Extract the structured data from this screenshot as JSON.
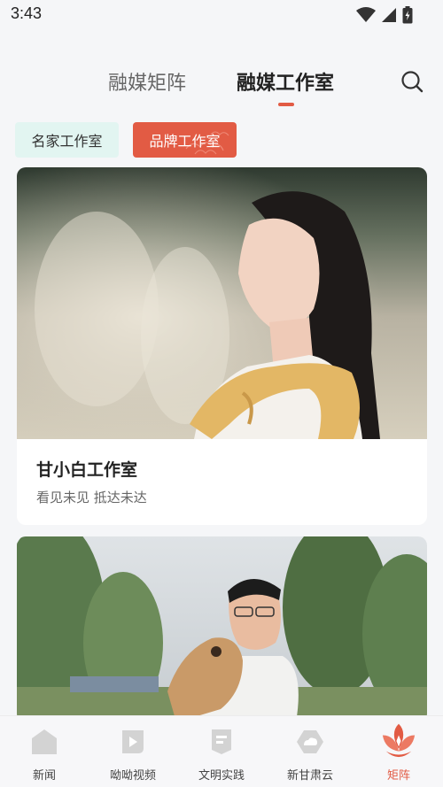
{
  "status_bar": {
    "time": "3:43"
  },
  "top_tabs": [
    {
      "label": "融媒矩阵"
    },
    {
      "label": "融媒工作室"
    }
  ],
  "chips": [
    {
      "label": "名家工作室"
    },
    {
      "label": "品牌工作室"
    }
  ],
  "cards": [
    {
      "title": "甘小白工作室",
      "subtitle": "看见未见  抵达未达"
    },
    {
      "title": "",
      "subtitle": ""
    }
  ],
  "bottom_nav": [
    {
      "label": "新闻",
      "icon": "house-icon"
    },
    {
      "label": "呦呦视频",
      "icon": "play-icon"
    },
    {
      "label": "文明实践",
      "icon": "bookmark-icon"
    },
    {
      "label": "新甘肃云",
      "icon": "cloud-icon"
    },
    {
      "label": "矩阵",
      "icon": "lotus-icon"
    }
  ],
  "colors": {
    "accent": "#e25b44",
    "chip_inactive_bg": "#e2f5f1",
    "background": "#f5f6f8"
  }
}
